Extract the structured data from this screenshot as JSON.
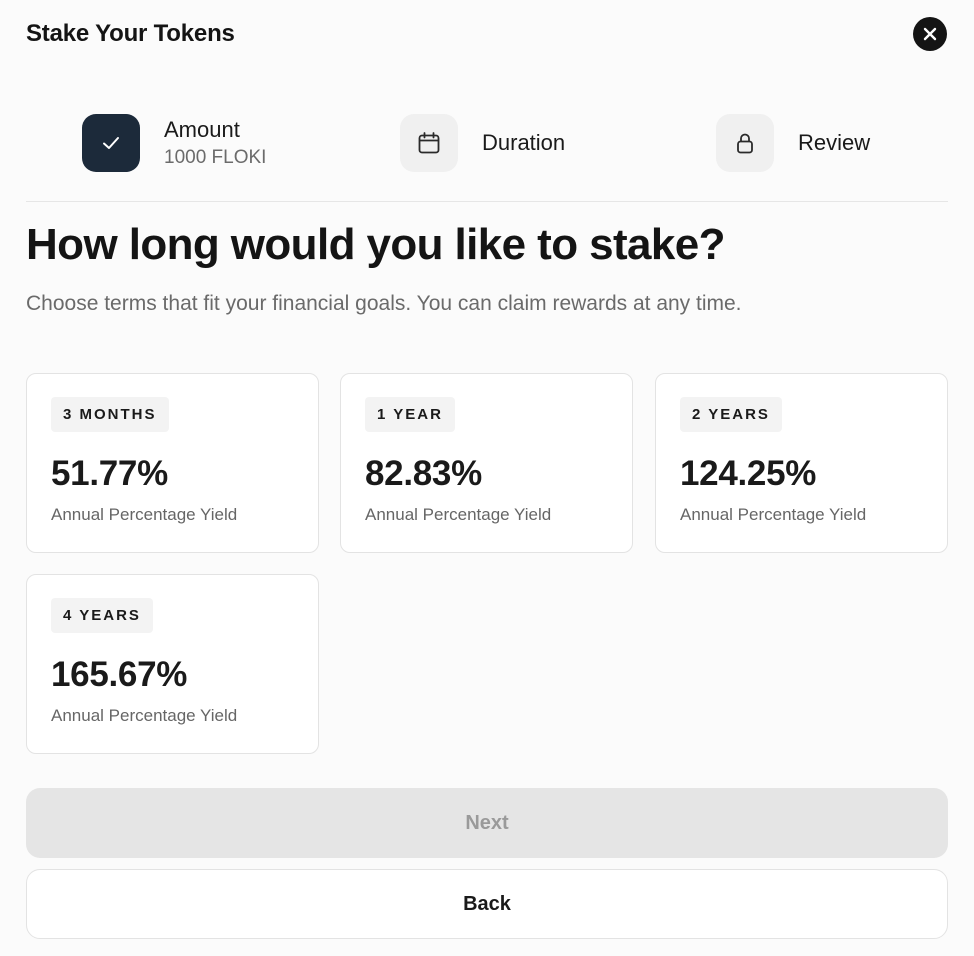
{
  "header": {
    "title": "Stake Your Tokens",
    "close_icon": "close-icon"
  },
  "steps": [
    {
      "label": "Amount",
      "sublabel": "1000 FLOKI",
      "state": "completed",
      "icon": "check-icon"
    },
    {
      "label": "Duration",
      "state": "current",
      "icon": "calendar-icon"
    },
    {
      "label": "Review",
      "state": "locked",
      "icon": "lock-icon"
    }
  ],
  "main": {
    "question": "How long would you like to stake?",
    "subtitle": "Choose terms that fit your financial goals. You can claim rewards at any time."
  },
  "options": [
    {
      "term": "3 MONTHS",
      "rate": "51.77%",
      "caption": "Annual Percentage Yield"
    },
    {
      "term": "1 YEAR",
      "rate": "82.83%",
      "caption": "Annual Percentage Yield"
    },
    {
      "term": "2 YEARS",
      "rate": "124.25%",
      "caption": "Annual Percentage Yield"
    },
    {
      "term": "4 YEARS",
      "rate": "165.67%",
      "caption": "Annual Percentage Yield"
    }
  ],
  "actions": {
    "next_label": "Next",
    "next_disabled": true,
    "back_label": "Back"
  },
  "colors": {
    "primary_dark": "#1c2a3a",
    "close_bg": "#141414",
    "disabled_bg": "#e5e5e5",
    "disabled_text": "#9a9a9a"
  }
}
